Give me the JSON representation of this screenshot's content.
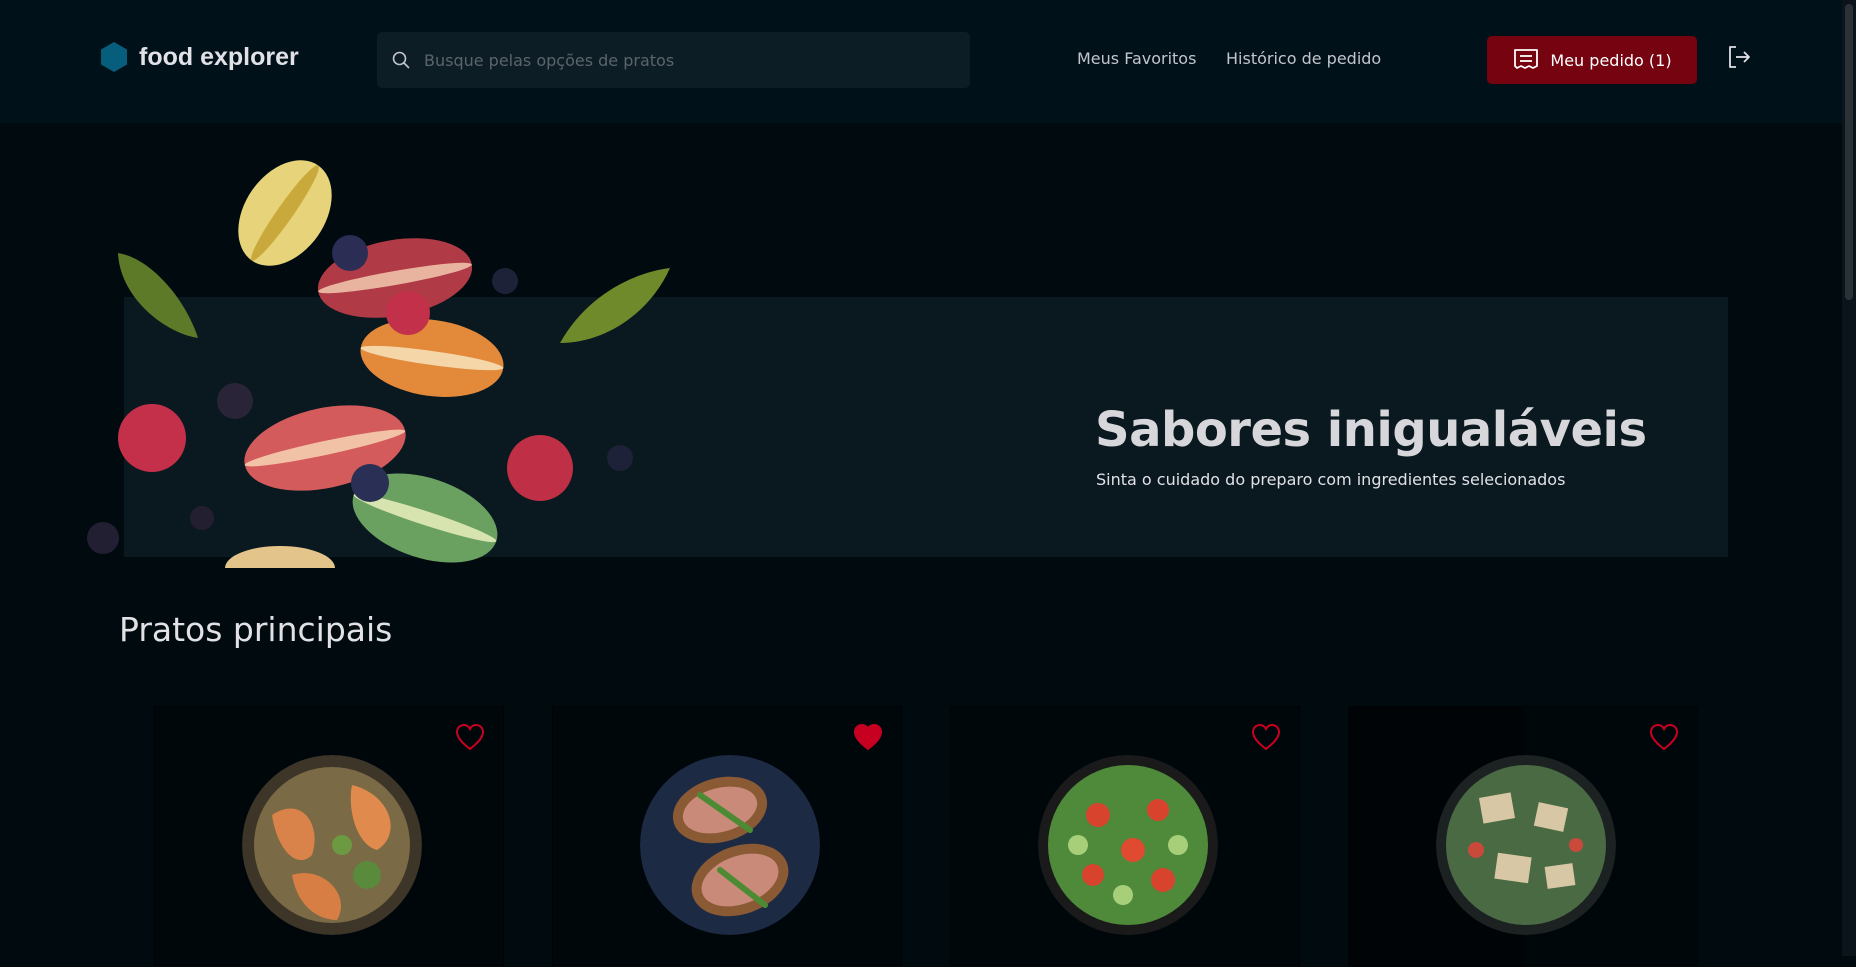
{
  "brand": {
    "name": "food explorer",
    "color": "#065e7c"
  },
  "search": {
    "placeholder": "Busque pelas opções de pratos",
    "value": ""
  },
  "nav": {
    "favorites": "Meus Favoritos",
    "history": "Histórico de pedido"
  },
  "order_button": {
    "label": "Meu pedido (1)",
    "color": "#750310"
  },
  "banner": {
    "title": "Sabores inigualáveis",
    "subtitle": "Sinta o cuidado do preparo com ingredientes selecionados"
  },
  "section": {
    "title": "Pratos principais"
  },
  "dishes": [
    {
      "image": "shrimp-pasta",
      "favorite": false
    },
    {
      "image": "bacon-toast",
      "favorite": true
    },
    {
      "image": "green-salad",
      "favorite": false
    },
    {
      "image": "parmesan-salad",
      "favorite": false
    }
  ],
  "colors": {
    "favorite": "#c70022",
    "background": "#000a0f",
    "header": "#00111a"
  }
}
